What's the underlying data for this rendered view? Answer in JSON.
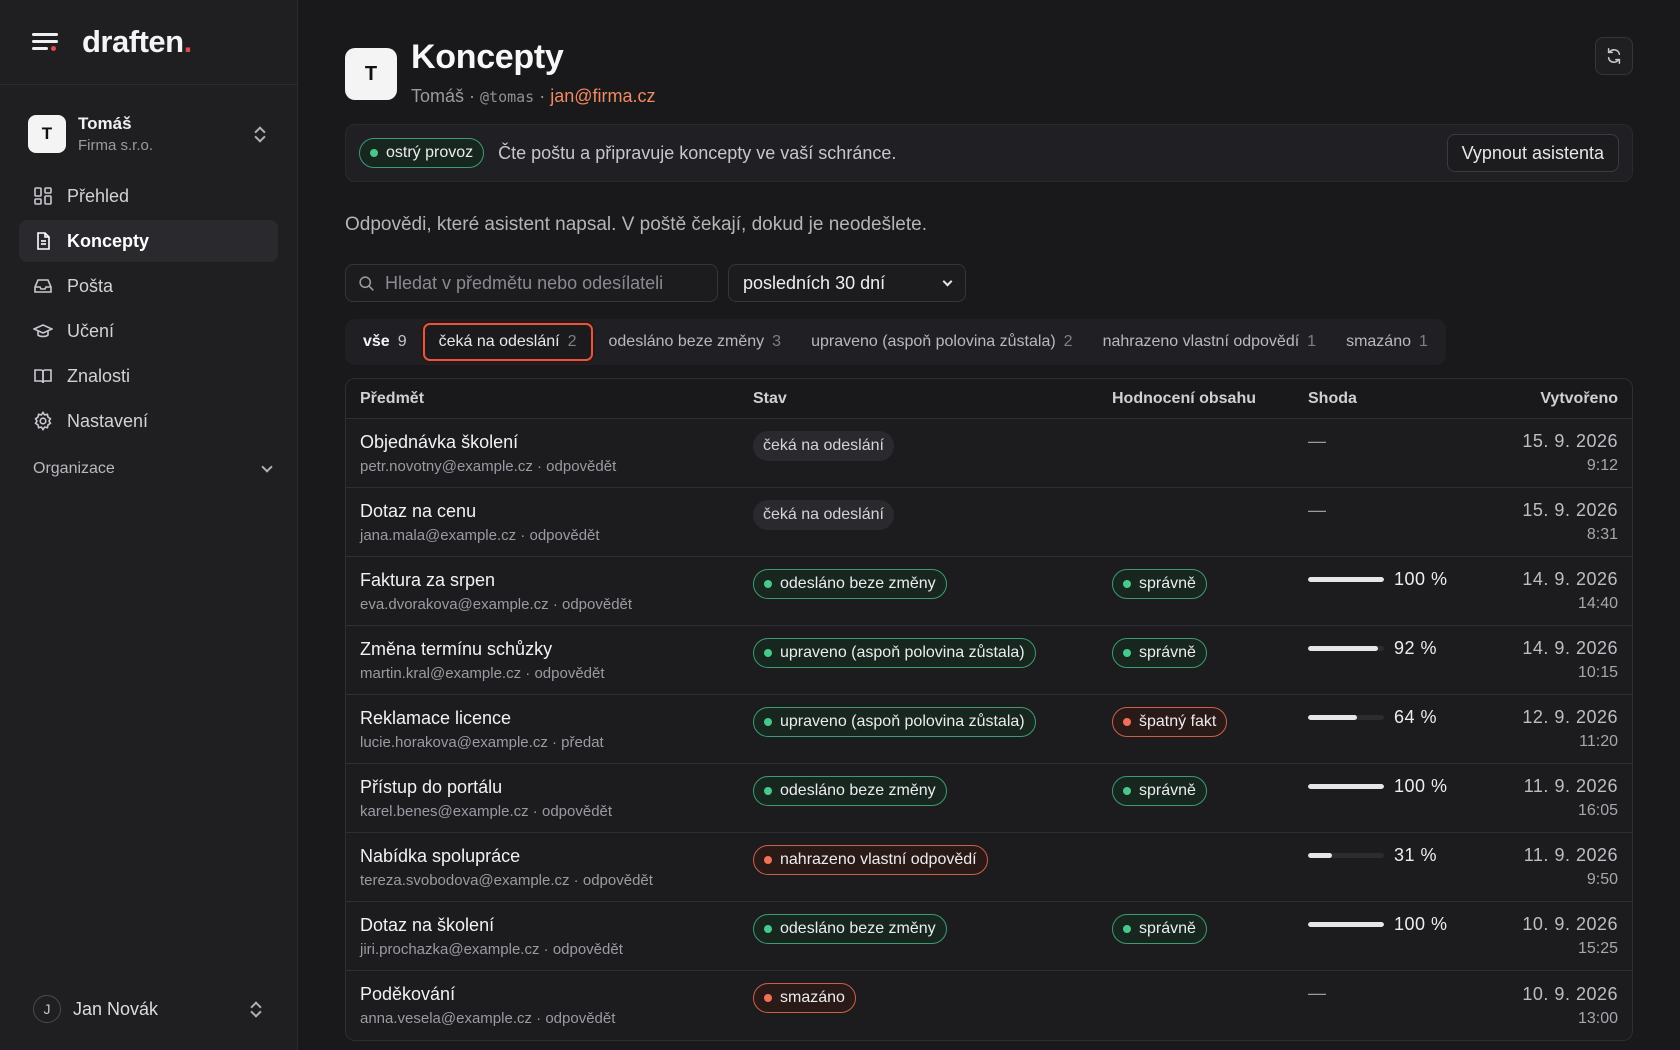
{
  "brand": {
    "name": "draften",
    "dot": "."
  },
  "account": {
    "initial": "T",
    "name": "Tomáš",
    "org": "Firma s.r.o."
  },
  "nav": [
    {
      "label": "Přehled",
      "icon": "dashboard-icon",
      "active": false
    },
    {
      "label": "Koncepty",
      "icon": "document-icon",
      "active": true
    },
    {
      "label": "Pošta",
      "icon": "inbox-icon",
      "active": false
    },
    {
      "label": "Učení",
      "icon": "graduation-cap-icon",
      "active": false
    },
    {
      "label": "Znalosti",
      "icon": "book-icon",
      "active": false
    },
    {
      "label": "Nastavení",
      "icon": "gear-icon",
      "active": false
    }
  ],
  "org_section": {
    "label": "Organizace"
  },
  "user": {
    "initial": "J",
    "name": "Jan Novák"
  },
  "header": {
    "initial": "T",
    "title": "Koncepty",
    "name": "Tomáš",
    "sep": " · ",
    "handle": "@tomas",
    "email": "jan@firma.cz"
  },
  "status": {
    "badge": "ostrý provoz",
    "text": "Čte poštu a připravuje koncepty ve vaší schránce.",
    "button": "Vypnout asistenta"
  },
  "intro": "Odpovědi, které asistent napsal. V poště čekají, dokud je neodešlete.",
  "search": {
    "placeholder": "Hledat v předmětu nebo odesílateli",
    "value": ""
  },
  "range": {
    "selected": "posledních 30 dní"
  },
  "tabs": [
    {
      "label": "vše",
      "count": "9"
    },
    {
      "label": "čeká na odeslání",
      "count": "2"
    },
    {
      "label": "odesláno beze změny",
      "count": "3"
    },
    {
      "label": "upraveno (aspoň polovina zůstala)",
      "count": "2"
    },
    {
      "label": "nahrazeno vlastní odpovědí",
      "count": "1"
    },
    {
      "label": "smazáno",
      "count": "1"
    }
  ],
  "table": {
    "headers": [
      "Předmět",
      "Stav",
      "Hodnocení obsahu",
      "Shoda",
      "Vytvořeno"
    ],
    "rows": [
      {
        "subject": "Objednávka školení",
        "sender": "petr.novotny@example.cz",
        "action": "odpovědět",
        "status": "čeká na odeslání",
        "tone": "gray",
        "rating": "",
        "rating_tone": "",
        "match": "—",
        "match_value": null,
        "date": "15. 9. 2026",
        "time": "9:12"
      },
      {
        "subject": "Dotaz na cenu",
        "sender": "jana.mala@example.cz",
        "action": "odpovědět",
        "status": "čeká na odeslání",
        "tone": "gray",
        "rating": "",
        "rating_tone": "",
        "match": "—",
        "match_value": null,
        "date": "15. 9. 2026",
        "time": "8:31"
      },
      {
        "subject": "Faktura za srpen",
        "sender": "eva.dvorakova@example.cz",
        "action": "odpovědět",
        "status": "odesláno beze změny",
        "tone": "green",
        "rating": "správně",
        "rating_tone": "green",
        "match": "100 %",
        "match_value": 100,
        "date": "14. 9. 2026",
        "time": "14:40"
      },
      {
        "subject": "Změna termínu schůzky",
        "sender": "martin.kral@example.cz",
        "action": "odpovědět",
        "status": "upraveno (aspoň polovina zůstala)",
        "tone": "green",
        "rating": "správně",
        "rating_tone": "green",
        "match": "92 %",
        "match_value": 92,
        "date": "14. 9. 2026",
        "time": "10:15"
      },
      {
        "subject": "Reklamace licence",
        "sender": "lucie.horakova@example.cz",
        "action": "předat",
        "status": "upraveno (aspoň polovina zůstala)",
        "tone": "green",
        "rating": "špatný fakt",
        "rating_tone": "red",
        "match": "64 %",
        "match_value": 64,
        "date": "12. 9. 2026",
        "time": "11:20"
      },
      {
        "subject": "Přístup do portálu",
        "sender": "karel.benes@example.cz",
        "action": "odpovědět",
        "status": "odesláno beze změny",
        "tone": "green",
        "rating": "správně",
        "rating_tone": "green",
        "match": "100 %",
        "match_value": 100,
        "date": "11. 9. 2026",
        "time": "16:05"
      },
      {
        "subject": "Nabídka spolupráce",
        "sender": "tereza.svobodova@example.cz",
        "action": "odpovědět",
        "status": "nahrazeno vlastní odpovědí",
        "tone": "red",
        "rating": "",
        "rating_tone": "",
        "match": "31 %",
        "match_value": 31,
        "date": "11. 9. 2026",
        "time": "9:50"
      },
      {
        "subject": "Dotaz na školení",
        "sender": "jiri.prochazka@example.cz",
        "action": "odpovědět",
        "status": "odesláno beze změny",
        "tone": "green",
        "rating": "správně",
        "rating_tone": "green",
        "match": "100 %",
        "match_value": 100,
        "date": "10. 9. 2026",
        "time": "15:25"
      },
      {
        "subject": "Poděkování",
        "sender": "anna.vesela@example.cz",
        "action": "odpovědět",
        "status": "smazáno",
        "tone": "red",
        "rating": "",
        "rating_tone": "",
        "match": "—",
        "match_value": null,
        "date": "10. 9. 2026",
        "time": "13:00"
      }
    ]
  }
}
